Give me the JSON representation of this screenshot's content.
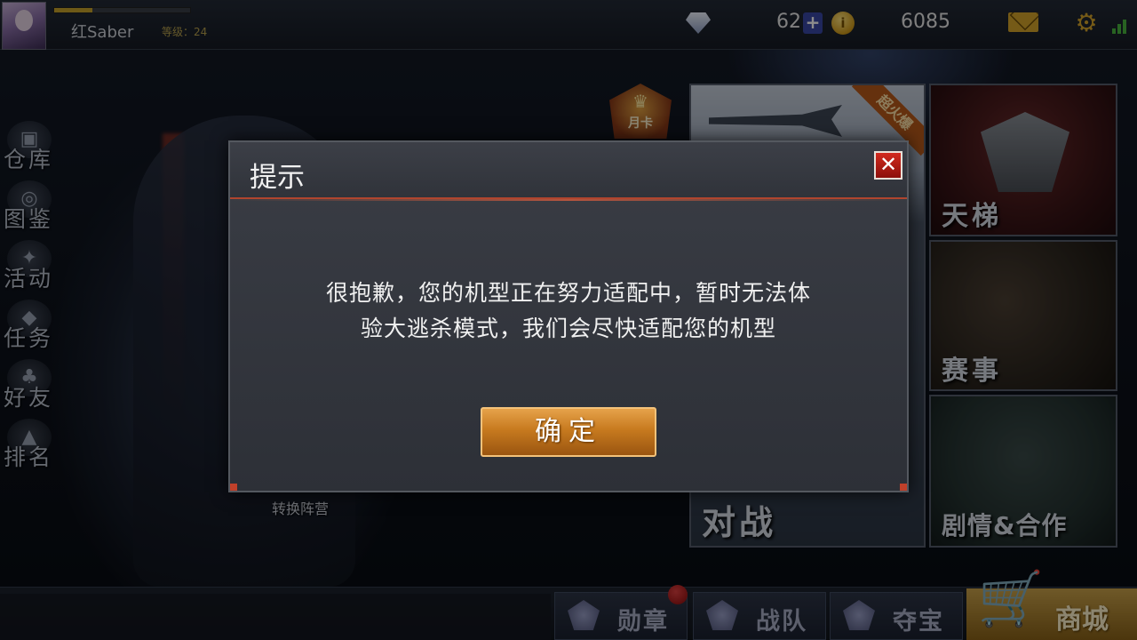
{
  "player": {
    "name": "红Saber",
    "level_label": "等级：24",
    "xp_progress": 0.28
  },
  "currency": {
    "gems": "62",
    "coins": "6085",
    "add_symbol": "+"
  },
  "left_menu": [
    {
      "label": "仓库",
      "icon": "warehouse-icon"
    },
    {
      "label": "图鉴",
      "icon": "catalog-icon"
    },
    {
      "label": "活动",
      "icon": "events-icon"
    },
    {
      "label": "任务",
      "icon": "tasks-icon"
    },
    {
      "label": "好友",
      "icon": "friends-icon"
    },
    {
      "label": "排名",
      "icon": "ranking-icon"
    }
  ],
  "modes": {
    "month_card": "月卡",
    "battle": "对战",
    "battle_hot": "超火爆",
    "ladder": "天梯",
    "event": "赛事",
    "story": "剧情&合作"
  },
  "switch_camp": "转换阵营",
  "bottom_nav": {
    "medals": "勋章",
    "team": "战队",
    "treasure": "夺宝",
    "shop": "商城"
  },
  "dialog": {
    "title": "提示",
    "close": "✕",
    "message_line1": "很抱歉，您的机型正在努力适配中，暂时无法体",
    "message_line2": "验大逃杀模式，我们会尽快适配您的机型",
    "confirm": "确定"
  },
  "colors": {
    "accent_red": "#b0452e",
    "button_orange": "#c77a1f",
    "gold": "#d5a42a",
    "signal_green": "#49b53e"
  }
}
